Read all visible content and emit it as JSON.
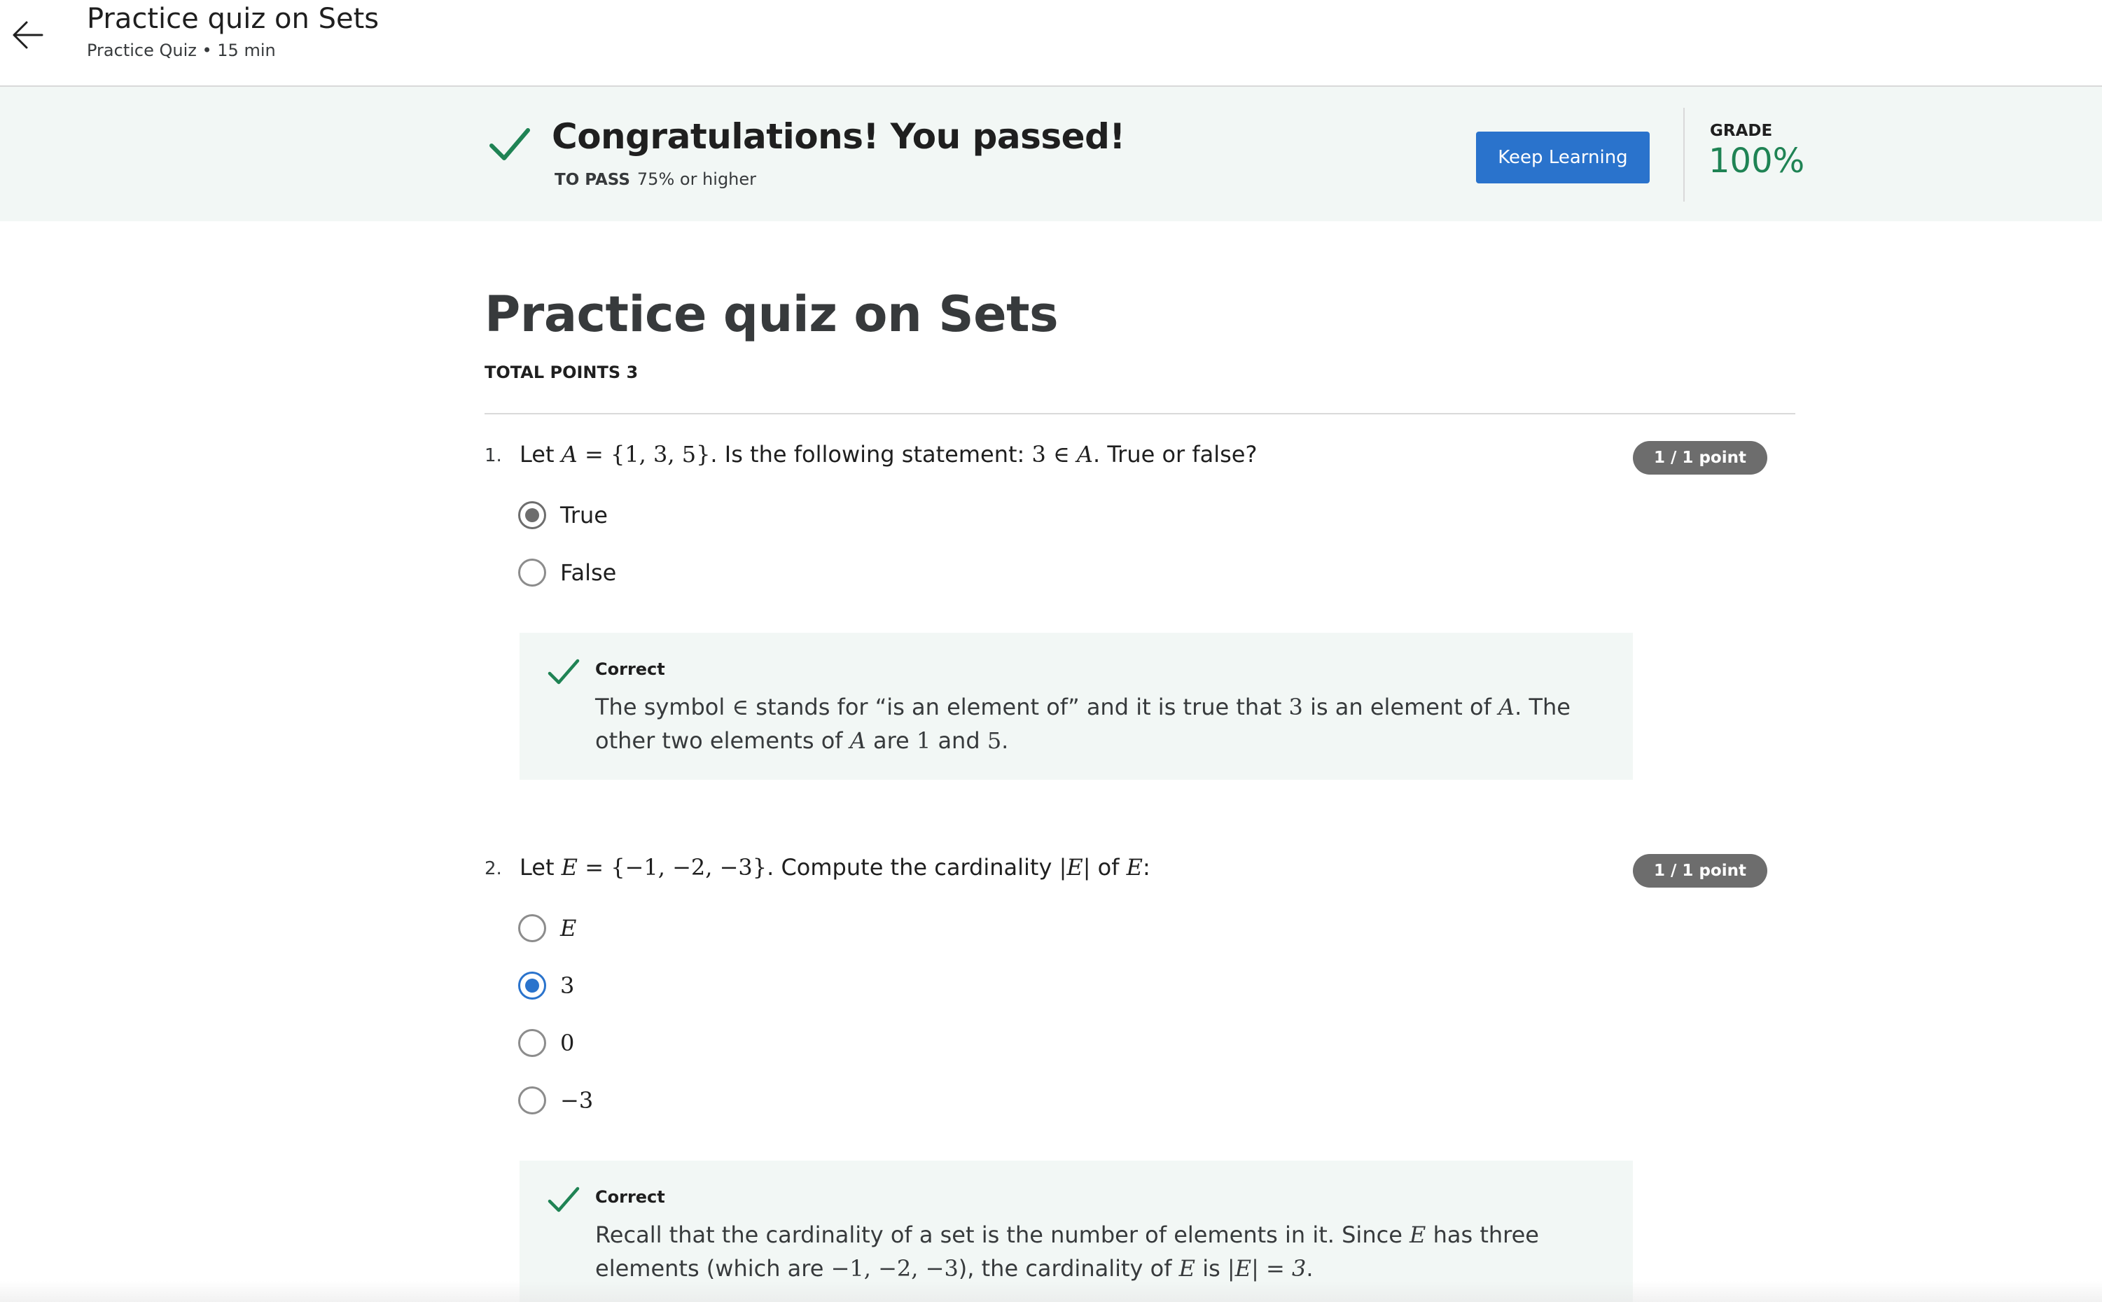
{
  "header": {
    "title": "Practice quiz on Sets",
    "subtitle": "Practice Quiz • 15 min",
    "back_icon": "arrow-left-icon"
  },
  "banner": {
    "icon": "check-icon",
    "title": "Congratulations! You passed!",
    "to_pass_label": "TO PASS",
    "to_pass_value": "75% or higher",
    "button_label": "Keep Learning",
    "grade_label": "GRADE",
    "grade_value": "100%",
    "accent_color": "#1f8354",
    "button_color": "#2a73cc"
  },
  "quiz": {
    "title": "Practice quiz on Sets",
    "total_points": "TOTAL POINTS 3",
    "questions": [
      {
        "number": "1.",
        "text": {
          "a": "Let",
          "b": "A",
          "c": "=",
          "d": "{1, 3, 5}",
          "e": ". Is the following statement:",
          "f": "3",
          "g": "∈",
          "h": "A",
          "i": ". True or false?"
        },
        "points": "1 / 1 point",
        "options": [
          {
            "label": "True",
            "selected": true
          },
          {
            "label": "False",
            "selected": false
          }
        ],
        "feedback": {
          "status": "Correct",
          "text": {
            "a": "The symbol",
            "b": "∈",
            "c": "stands for “is an element of” and it is true that",
            "d": "3",
            "e": "is an element of",
            "f": "A",
            "g": ". The other two elements of",
            "h": "A",
            "i": "are",
            "j": "1",
            "k": "and",
            "l": "5",
            "m": "."
          }
        }
      },
      {
        "number": "2.",
        "text": {
          "a": "Let",
          "b": "E",
          "c": "=",
          "d": "{−1, −2, −3}",
          "e": ". Compute the cardinality",
          "f": "|E|",
          "g": "of",
          "h": "E",
          "i": ":"
        },
        "points": "1 / 1 point",
        "options": [
          {
            "label": "E",
            "selected": false
          },
          {
            "label": "3",
            "selected": true
          },
          {
            "label": "0",
            "selected": false
          },
          {
            "label": "−3",
            "selected": false
          }
        ],
        "feedback": {
          "status": "Correct",
          "text": {
            "a": "Recall that the cardinality of a set is the number of elements in it. Since",
            "b": "E",
            "c": "has three elements (which are",
            "d": "−1, −2, −3",
            "e": "), the cardinality of",
            "f": "E",
            "g": "is",
            "h": "|E| = 3",
            "i": "."
          }
        }
      }
    ]
  }
}
